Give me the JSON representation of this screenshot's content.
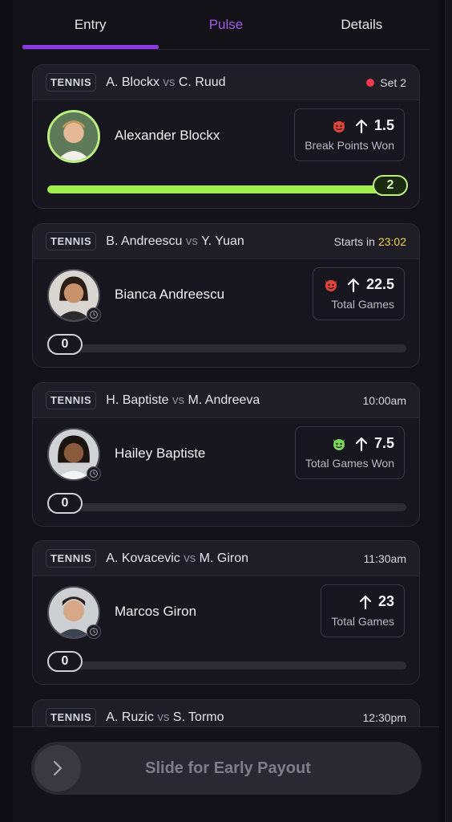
{
  "tabs": [
    {
      "label": "Entry",
      "active": true
    },
    {
      "label": "Pulse",
      "active": false
    },
    {
      "label": "Details",
      "active": false
    }
  ],
  "cards": [
    {
      "sport": "TENNIS",
      "player1": "A. Blockx",
      "vs": "vs",
      "player2": "C. Ruud",
      "status": "Set 2",
      "live": true,
      "player_name": "Alexander Blockx",
      "emoji_icon": "devil-red-icon",
      "direction": "up-arrow-icon",
      "line": "1.5",
      "stat": "Break Points Won",
      "progress_value": "2",
      "progress_fraction": 1.0
    },
    {
      "sport": "TENNIS",
      "player1": "B. Andreescu",
      "vs": "vs",
      "player2": "Y. Yuan",
      "status_prefix": "Starts in",
      "status_time": "23:02",
      "player_name": "Bianca Andreescu",
      "emoji_icon": "devil-red-icon",
      "direction": "up-arrow-icon",
      "line": "22.5",
      "stat": "Total Games",
      "progress_value": "0",
      "progress_fraction": 0
    },
    {
      "sport": "TENNIS",
      "player1": "H. Baptiste",
      "vs": "vs",
      "player2": "M. Andreeva",
      "status": "10:00am",
      "player_name": "Hailey Baptiste",
      "emoji_icon": "devil-green-icon",
      "direction": "up-arrow-icon",
      "line": "7.5",
      "stat": "Total Games Won",
      "progress_value": "0",
      "progress_fraction": 0
    },
    {
      "sport": "TENNIS",
      "player1": "A. Kovacevic",
      "vs": "vs",
      "player2": "M. Giron",
      "status": "11:30am",
      "player_name": "Marcos Giron",
      "direction": "up-arrow-icon",
      "line": "23",
      "stat": "Total Games",
      "progress_value": "0",
      "progress_fraction": 0
    },
    {
      "sport": "TENNIS",
      "player1": "A. Ruzic",
      "vs": "vs",
      "player2": "S. Tormo",
      "status": "12:30pm"
    }
  ],
  "slider": {
    "label": "Slide for Early Payout",
    "icon": "chevron-right-icon"
  },
  "colors": {
    "accent_purple": "#8b3be6",
    "live_green": "#9ff04a",
    "live_red": "#f03a4c",
    "countdown_yellow": "#f0d24a"
  }
}
